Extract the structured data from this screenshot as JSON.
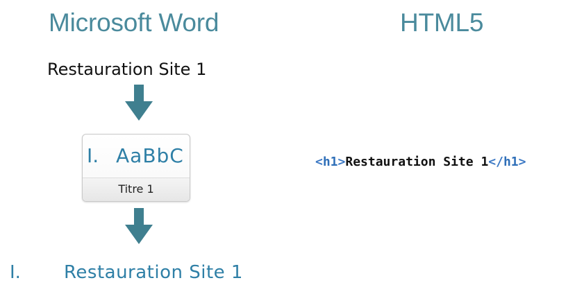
{
  "word_column": {
    "title": "Microsoft Word",
    "source_text": "Restauration Site 1",
    "style_gallery": {
      "preview_number": "I.",
      "preview_sample": "AaBbC",
      "style_name": "Titre 1"
    },
    "result": {
      "number": "I.",
      "text": "Restauration Site 1"
    }
  },
  "html_column": {
    "title": "HTML5",
    "code": {
      "open_lt": "<",
      "open_tag": "h1",
      "open_gt": ">",
      "content": "Restauration Site 1",
      "close_lt": "</",
      "close_tag": "h1",
      "close_gt": ">"
    }
  },
  "colors": {
    "title": "#4a8a9c",
    "heading_blue": "#2e7fa6",
    "arrow": "#3f7f8f",
    "code_tag": "#3b78c4"
  },
  "icons": {
    "arrow_top": "arrow-down-icon",
    "arrow_bottom": "arrow-down-icon"
  }
}
